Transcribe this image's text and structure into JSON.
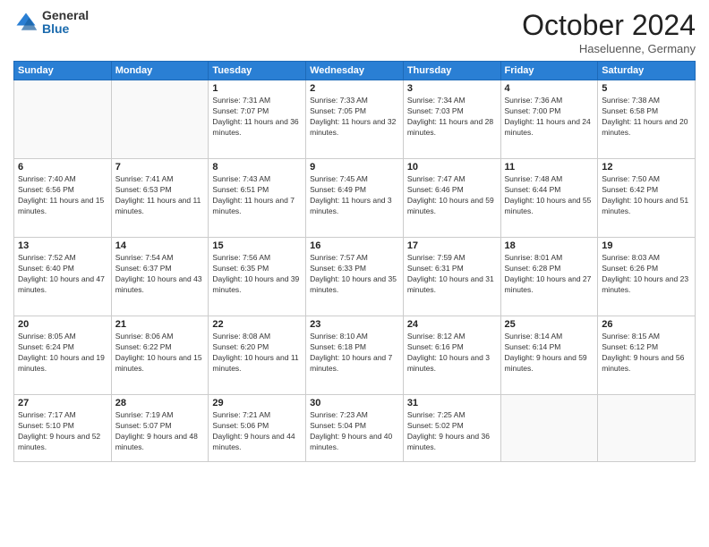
{
  "logo": {
    "general": "General",
    "blue": "Blue"
  },
  "header": {
    "month": "October 2024",
    "location": "Haseluenne, Germany"
  },
  "weekdays": [
    "Sunday",
    "Monday",
    "Tuesday",
    "Wednesday",
    "Thursday",
    "Friday",
    "Saturday"
  ],
  "weeks": [
    [
      {
        "day": "",
        "sunrise": "",
        "sunset": "",
        "daylight": ""
      },
      {
        "day": "",
        "sunrise": "",
        "sunset": "",
        "daylight": ""
      },
      {
        "day": "1",
        "sunrise": "Sunrise: 7:31 AM",
        "sunset": "Sunset: 7:07 PM",
        "daylight": "Daylight: 11 hours and 36 minutes."
      },
      {
        "day": "2",
        "sunrise": "Sunrise: 7:33 AM",
        "sunset": "Sunset: 7:05 PM",
        "daylight": "Daylight: 11 hours and 32 minutes."
      },
      {
        "day": "3",
        "sunrise": "Sunrise: 7:34 AM",
        "sunset": "Sunset: 7:03 PM",
        "daylight": "Daylight: 11 hours and 28 minutes."
      },
      {
        "day": "4",
        "sunrise": "Sunrise: 7:36 AM",
        "sunset": "Sunset: 7:00 PM",
        "daylight": "Daylight: 11 hours and 24 minutes."
      },
      {
        "day": "5",
        "sunrise": "Sunrise: 7:38 AM",
        "sunset": "Sunset: 6:58 PM",
        "daylight": "Daylight: 11 hours and 20 minutes."
      }
    ],
    [
      {
        "day": "6",
        "sunrise": "Sunrise: 7:40 AM",
        "sunset": "Sunset: 6:56 PM",
        "daylight": "Daylight: 11 hours and 15 minutes."
      },
      {
        "day": "7",
        "sunrise": "Sunrise: 7:41 AM",
        "sunset": "Sunset: 6:53 PM",
        "daylight": "Daylight: 11 hours and 11 minutes."
      },
      {
        "day": "8",
        "sunrise": "Sunrise: 7:43 AM",
        "sunset": "Sunset: 6:51 PM",
        "daylight": "Daylight: 11 hours and 7 minutes."
      },
      {
        "day": "9",
        "sunrise": "Sunrise: 7:45 AM",
        "sunset": "Sunset: 6:49 PM",
        "daylight": "Daylight: 11 hours and 3 minutes."
      },
      {
        "day": "10",
        "sunrise": "Sunrise: 7:47 AM",
        "sunset": "Sunset: 6:46 PM",
        "daylight": "Daylight: 10 hours and 59 minutes."
      },
      {
        "day": "11",
        "sunrise": "Sunrise: 7:48 AM",
        "sunset": "Sunset: 6:44 PM",
        "daylight": "Daylight: 10 hours and 55 minutes."
      },
      {
        "day": "12",
        "sunrise": "Sunrise: 7:50 AM",
        "sunset": "Sunset: 6:42 PM",
        "daylight": "Daylight: 10 hours and 51 minutes."
      }
    ],
    [
      {
        "day": "13",
        "sunrise": "Sunrise: 7:52 AM",
        "sunset": "Sunset: 6:40 PM",
        "daylight": "Daylight: 10 hours and 47 minutes."
      },
      {
        "day": "14",
        "sunrise": "Sunrise: 7:54 AM",
        "sunset": "Sunset: 6:37 PM",
        "daylight": "Daylight: 10 hours and 43 minutes."
      },
      {
        "day": "15",
        "sunrise": "Sunrise: 7:56 AM",
        "sunset": "Sunset: 6:35 PM",
        "daylight": "Daylight: 10 hours and 39 minutes."
      },
      {
        "day": "16",
        "sunrise": "Sunrise: 7:57 AM",
        "sunset": "Sunset: 6:33 PM",
        "daylight": "Daylight: 10 hours and 35 minutes."
      },
      {
        "day": "17",
        "sunrise": "Sunrise: 7:59 AM",
        "sunset": "Sunset: 6:31 PM",
        "daylight": "Daylight: 10 hours and 31 minutes."
      },
      {
        "day": "18",
        "sunrise": "Sunrise: 8:01 AM",
        "sunset": "Sunset: 6:28 PM",
        "daylight": "Daylight: 10 hours and 27 minutes."
      },
      {
        "day": "19",
        "sunrise": "Sunrise: 8:03 AM",
        "sunset": "Sunset: 6:26 PM",
        "daylight": "Daylight: 10 hours and 23 minutes."
      }
    ],
    [
      {
        "day": "20",
        "sunrise": "Sunrise: 8:05 AM",
        "sunset": "Sunset: 6:24 PM",
        "daylight": "Daylight: 10 hours and 19 minutes."
      },
      {
        "day": "21",
        "sunrise": "Sunrise: 8:06 AM",
        "sunset": "Sunset: 6:22 PM",
        "daylight": "Daylight: 10 hours and 15 minutes."
      },
      {
        "day": "22",
        "sunrise": "Sunrise: 8:08 AM",
        "sunset": "Sunset: 6:20 PM",
        "daylight": "Daylight: 10 hours and 11 minutes."
      },
      {
        "day": "23",
        "sunrise": "Sunrise: 8:10 AM",
        "sunset": "Sunset: 6:18 PM",
        "daylight": "Daylight: 10 hours and 7 minutes."
      },
      {
        "day": "24",
        "sunrise": "Sunrise: 8:12 AM",
        "sunset": "Sunset: 6:16 PM",
        "daylight": "Daylight: 10 hours and 3 minutes."
      },
      {
        "day": "25",
        "sunrise": "Sunrise: 8:14 AM",
        "sunset": "Sunset: 6:14 PM",
        "daylight": "Daylight: 9 hours and 59 minutes."
      },
      {
        "day": "26",
        "sunrise": "Sunrise: 8:15 AM",
        "sunset": "Sunset: 6:12 PM",
        "daylight": "Daylight: 9 hours and 56 minutes."
      }
    ],
    [
      {
        "day": "27",
        "sunrise": "Sunrise: 7:17 AM",
        "sunset": "Sunset: 5:10 PM",
        "daylight": "Daylight: 9 hours and 52 minutes."
      },
      {
        "day": "28",
        "sunrise": "Sunrise: 7:19 AM",
        "sunset": "Sunset: 5:07 PM",
        "daylight": "Daylight: 9 hours and 48 minutes."
      },
      {
        "day": "29",
        "sunrise": "Sunrise: 7:21 AM",
        "sunset": "Sunset: 5:06 PM",
        "daylight": "Daylight: 9 hours and 44 minutes."
      },
      {
        "day": "30",
        "sunrise": "Sunrise: 7:23 AM",
        "sunset": "Sunset: 5:04 PM",
        "daylight": "Daylight: 9 hours and 40 minutes."
      },
      {
        "day": "31",
        "sunrise": "Sunrise: 7:25 AM",
        "sunset": "Sunset: 5:02 PM",
        "daylight": "Daylight: 9 hours and 36 minutes."
      },
      {
        "day": "",
        "sunrise": "",
        "sunset": "",
        "daylight": ""
      },
      {
        "day": "",
        "sunrise": "",
        "sunset": "",
        "daylight": ""
      }
    ]
  ]
}
